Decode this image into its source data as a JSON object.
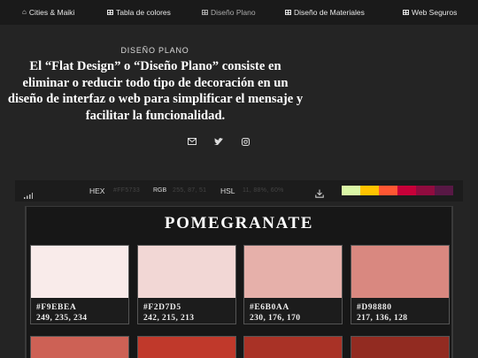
{
  "nav": {
    "items": [
      {
        "label": "Cities & Maiki",
        "icon": "home-icon"
      },
      {
        "label": "Tabla de colores",
        "icon": "table-icon"
      },
      {
        "label": "Diseño Plano",
        "icon": "table-icon"
      },
      {
        "label": "Diseño de Materiales",
        "icon": "table-icon"
      },
      {
        "label": "Web Seguros",
        "icon": "table-icon"
      }
    ]
  },
  "hero": {
    "subtitle": "DISEÑO PLANO",
    "headline": "El “Flat Design” o “Diseño Plano” consiste en eliminar o reducir todo tipo de decoración en un diseño de interfaz o web para simplificar el mensaje y facilitar la funcionalidad.",
    "social": [
      "envelope-icon",
      "twitter-icon",
      "instagram-icon"
    ]
  },
  "toolbar": {
    "hex_label": "HEX",
    "hex_value": "#FF5733",
    "rgb_label": "RGB",
    "rgb_value": "255, 87, 51",
    "hsl_label": "HSL",
    "hsl_value": "11, 88%, 60%",
    "swatches": [
      "#DAF7A6",
      "#FFC300",
      "#FF5733",
      "#C70039",
      "#900C3F",
      "#581845"
    ]
  },
  "palette": {
    "title": "POMEGRANATE",
    "cards": [
      {
        "hex": "#F9EBEA",
        "rgb": "249, 235, 234",
        "color": "#F9EBEA"
      },
      {
        "hex": "#F2D7D5",
        "rgb": "242, 215, 213",
        "color": "#F2D7D5"
      },
      {
        "hex": "#E6B0AA",
        "rgb": "230, 176, 170",
        "color": "#E6B0AA"
      },
      {
        "hex": "#D98880",
        "rgb": "217, 136, 128",
        "color": "#D98880"
      }
    ],
    "next_row_colors": [
      "#CD6155",
      "#C0392B",
      "#A93226",
      "#922B21"
    ]
  }
}
